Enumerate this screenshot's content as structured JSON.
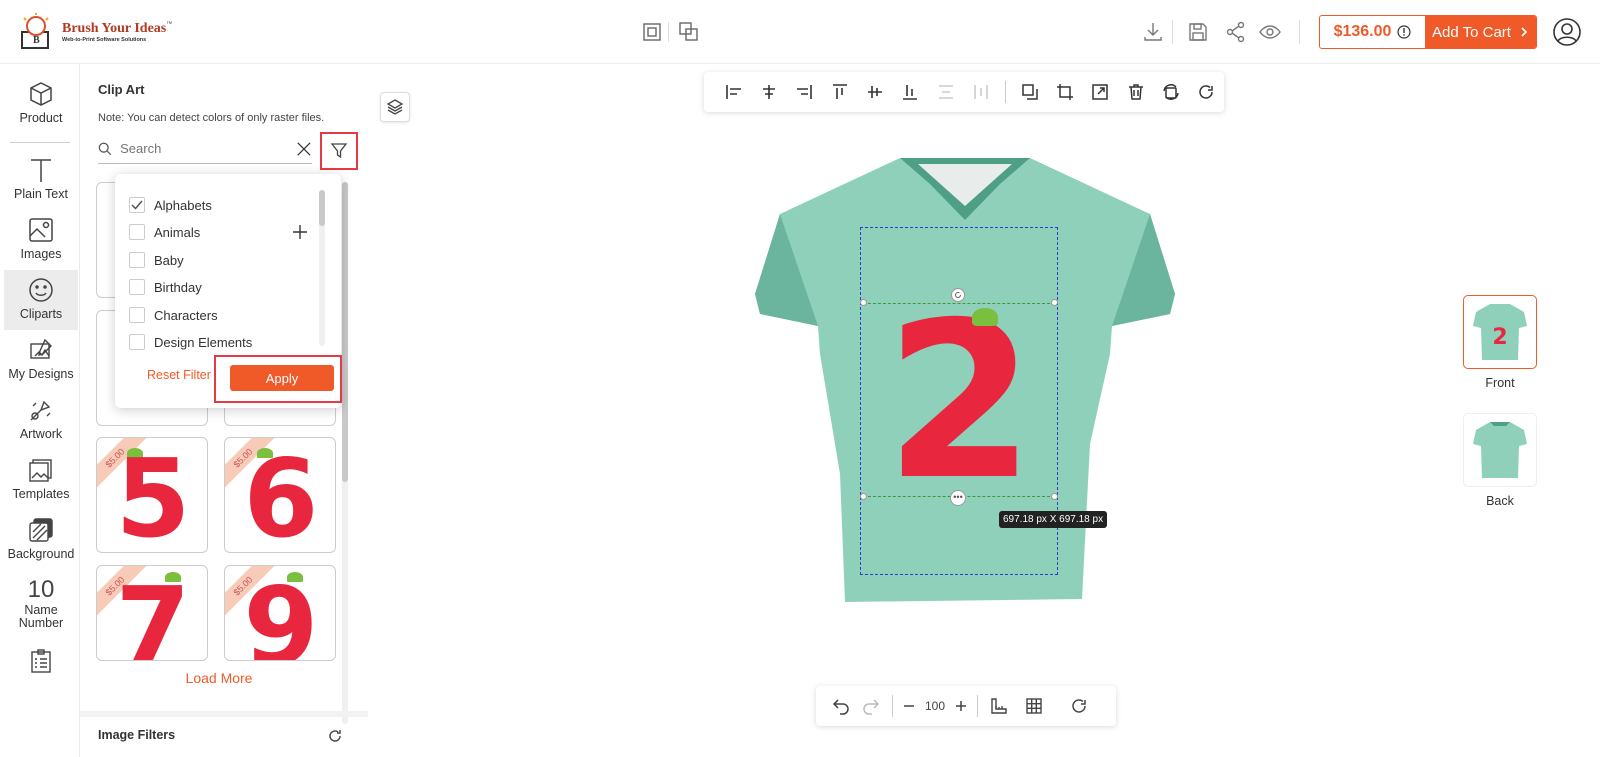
{
  "header": {
    "logo_title": "Brush Your Ideas",
    "logo_tm": "™",
    "logo_subtitle": "Web-to-Print Software Solutions",
    "price": "$136.00",
    "add_to_cart": "Add To Cart"
  },
  "sidebar": {
    "items": [
      {
        "label": "Product",
        "icon": "cube-icon"
      },
      {
        "label": "Plain Text",
        "icon": "text-icon"
      },
      {
        "label": "Images",
        "icon": "image-icon"
      },
      {
        "label": "Cliparts",
        "icon": "smiley-icon",
        "active": true
      },
      {
        "label": "My Designs",
        "icon": "my-designs-icon"
      },
      {
        "label": "Artwork",
        "icon": "artwork-icon"
      },
      {
        "label": "Templates",
        "icon": "templates-icon"
      },
      {
        "label": "Background",
        "icon": "background-icon"
      },
      {
        "label": "Name Number",
        "icon_text": "10"
      }
    ]
  },
  "panel": {
    "title": "Clip Art",
    "note": "Note: You can detect colors of only raster files.",
    "search_placeholder": "Search",
    "cards": [
      {
        "price": "$5.00",
        "digit": "5"
      },
      {
        "price": "$5.00",
        "digit": "6"
      },
      {
        "price": "$5.00",
        "digit": "7"
      },
      {
        "price": "$5.00",
        "digit": "9"
      }
    ],
    "load_more": "Load More",
    "image_filters": "Image Filters"
  },
  "filter_dropdown": {
    "categories": [
      {
        "label": "Alphabets",
        "checked": true
      },
      {
        "label": "Animals",
        "checked": false
      },
      {
        "label": "Baby",
        "checked": false
      },
      {
        "label": "Birthday",
        "checked": false
      },
      {
        "label": "Characters",
        "checked": false
      },
      {
        "label": "Design Elements",
        "checked": false
      }
    ],
    "reset_label": "Reset Filter",
    "apply_label": "Apply"
  },
  "canvas": {
    "design_digit": "2",
    "size_label": "697.18 px X 697.18 px",
    "zoom": "100",
    "views": [
      {
        "label": "Front",
        "selected": true
      },
      {
        "label": "Back",
        "selected": false
      }
    ]
  },
  "colors": {
    "accent": "#f05a28",
    "highlight": "#e63946",
    "shirt": "#8fd0bb",
    "strawberry": "#e8273f"
  }
}
